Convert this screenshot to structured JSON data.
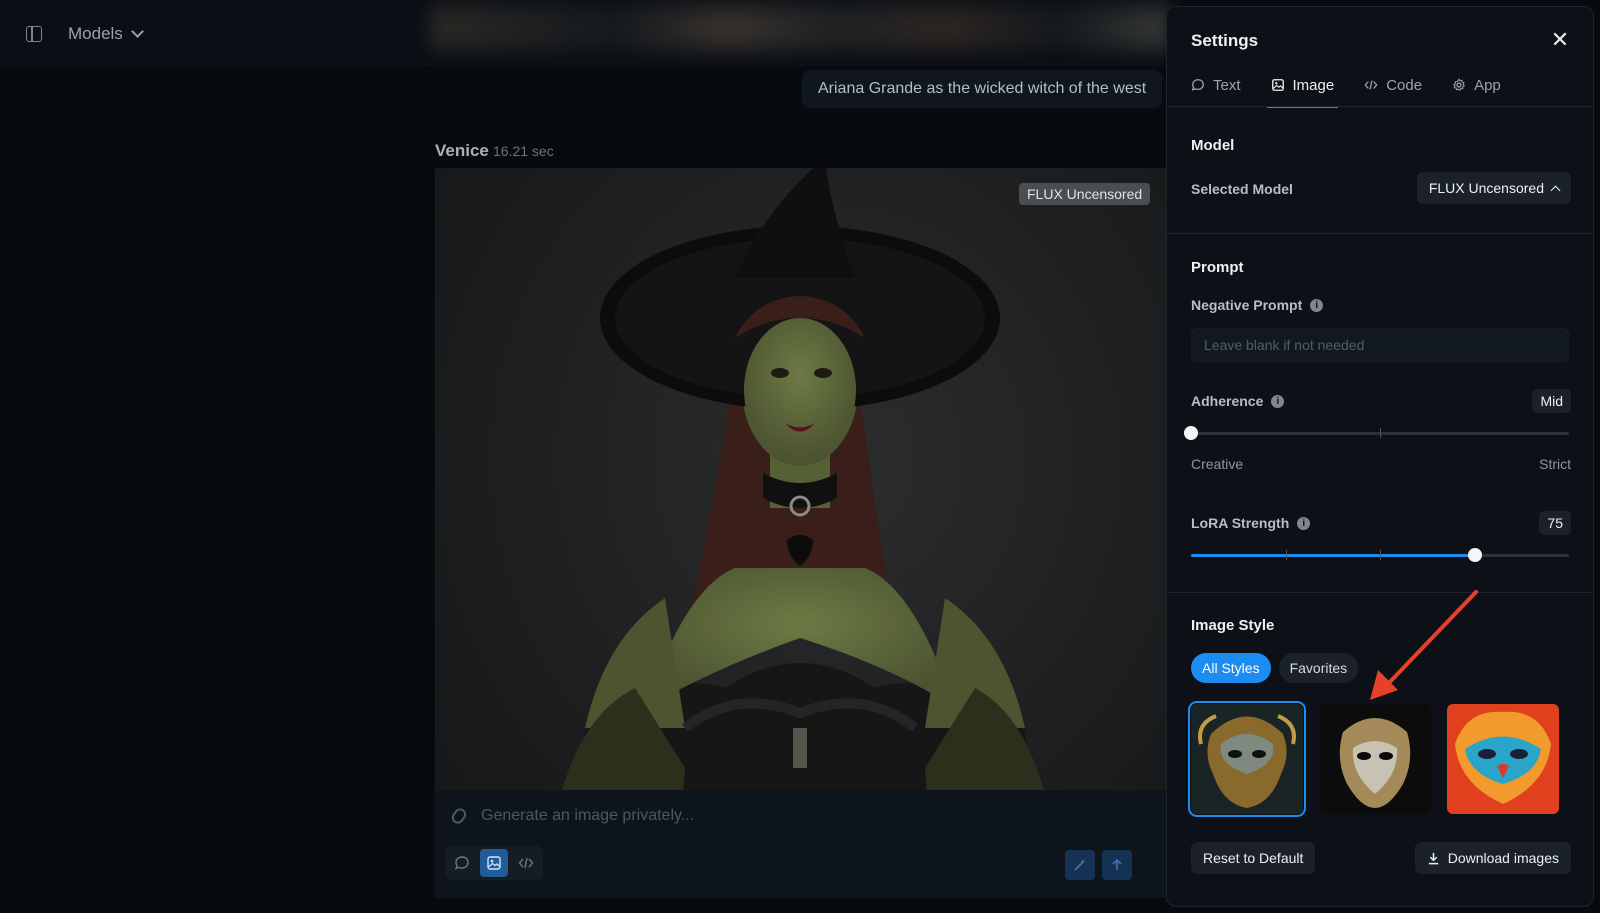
{
  "topbar": {
    "sidebar_icon": "sidebar-panel-icon",
    "models_label": "Models"
  },
  "chat": {
    "user_message": "Ariana Grande as the wicked witch of the west",
    "sender": "Venice",
    "elapsed": "16.21 sec",
    "image_badge": "FLUX Uncensored",
    "input_placeholder": "Generate an image privately...",
    "input_value": ""
  },
  "settings": {
    "title": "Settings",
    "tabs": [
      {
        "label": "Text",
        "icon": "chat-bubble-icon"
      },
      {
        "label": "Image",
        "icon": "image-icon"
      },
      {
        "label": "Code",
        "icon": "code-icon"
      },
      {
        "label": "App",
        "icon": "gear-icon"
      }
    ],
    "active_tab": "Image",
    "model": {
      "section": "Model",
      "selected_label": "Selected Model",
      "selected_value": "FLUX Uncensored"
    },
    "prompt": {
      "section": "Prompt",
      "negative_label": "Negative Prompt",
      "negative_placeholder": "Leave blank if not needed",
      "negative_value": ""
    },
    "adherence": {
      "label": "Adherence",
      "value_label": "Mid",
      "position": 0,
      "min_label": "Creative",
      "max_label": "Strict"
    },
    "lora": {
      "label": "LoRA Strength",
      "value": "75",
      "fraction": 0.75
    },
    "image_style": {
      "section": "Image Style",
      "chips": [
        "All Styles",
        "Favorites"
      ],
      "active_chip": "All Styles",
      "cards": [
        "ornate-gold-mask",
        "silver-gold-mask",
        "colorful-mask"
      ],
      "selected_card": 0
    },
    "reset_label": "Reset to Default",
    "download_label": "Download images"
  },
  "colors": {
    "accent": "#1d8cf0",
    "panel_bg": "#0d1117",
    "annotation_arrow": "#e5412b"
  }
}
